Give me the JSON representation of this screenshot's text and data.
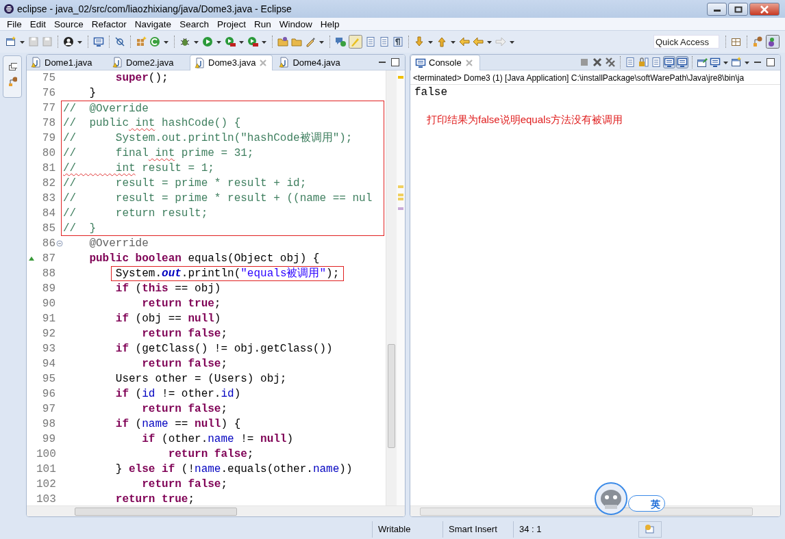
{
  "window": {
    "title": "eclipse - java_02/src/com/liaozhixiang/java/Dome3.java - Eclipse"
  },
  "menu": [
    "File",
    "Edit",
    "Source",
    "Refactor",
    "Navigate",
    "Search",
    "Project",
    "Run",
    "Window",
    "Help"
  ],
  "quick_access": {
    "placeholder": "Quick Access"
  },
  "editor": {
    "tabs": [
      {
        "label": "Dome1.java",
        "selected": false
      },
      {
        "label": "Dome2.java",
        "selected": false
      },
      {
        "label": "Dome3.java",
        "selected": true
      },
      {
        "label": "Dome4.java",
        "selected": false
      }
    ],
    "lines": [
      {
        "n": "75",
        "tokens": [
          {
            "kind": "keyword",
            "text": "        super"
          },
          {
            "kind": "plain",
            "text": "();"
          }
        ]
      },
      {
        "n": "76",
        "tokens": [
          {
            "kind": "plain",
            "text": "    }"
          }
        ]
      },
      {
        "n": "77",
        "boxed": true,
        "tokens": [
          {
            "kind": "comment",
            "text": "//  @Override"
          }
        ]
      },
      {
        "n": "78",
        "boxed": true,
        "tokens": [
          {
            "kind": "comment",
            "text": "//  public"
          },
          {
            "kind": "comment",
            "text": " int",
            "squiggly": true
          },
          {
            "kind": "comment",
            "text": " hashCode() {"
          }
        ]
      },
      {
        "n": "79",
        "boxed": true,
        "tokens": [
          {
            "kind": "comment",
            "text": "//      System.out.println(\"hashCode被调用\");"
          }
        ]
      },
      {
        "n": "80",
        "boxed": true,
        "tokens": [
          {
            "kind": "comment",
            "text": "//      final"
          },
          {
            "kind": "comment",
            "text": " int",
            "squiggly": true
          },
          {
            "kind": "comment",
            "text": " prime = 31;"
          }
        ]
      },
      {
        "n": "81",
        "boxed": true,
        "tokens": [
          {
            "kind": "comment",
            "text": "//      int",
            "squiggly": true
          },
          {
            "kind": "comment",
            "text": " result = 1;"
          }
        ]
      },
      {
        "n": "82",
        "boxed": true,
        "tokens": [
          {
            "kind": "comment",
            "text": "//      result = prime * result + id;"
          }
        ]
      },
      {
        "n": "83",
        "boxed": true,
        "tokens": [
          {
            "kind": "comment",
            "text": "//      result = prime * result + ((name == nul"
          }
        ]
      },
      {
        "n": "84",
        "boxed": true,
        "tokens": [
          {
            "kind": "comment",
            "text": "//      return result;"
          }
        ]
      },
      {
        "n": "85",
        "boxed": true,
        "tokens": [
          {
            "kind": "comment",
            "text": "//  }"
          }
        ]
      },
      {
        "n": "86",
        "foldable": true,
        "tokens": [
          {
            "kind": "annotation",
            "text": "    @Override"
          }
        ]
      },
      {
        "n": "87",
        "overrides": true,
        "tokens": [
          {
            "kind": "keyword",
            "text": "    public boolean"
          },
          {
            "kind": "plain",
            "text": " equals(Object obj) {"
          }
        ]
      },
      {
        "n": "88",
        "text_boxed": true,
        "tokens": [
          {
            "kind": "plain",
            "text": "        System."
          },
          {
            "kind": "static",
            "text": "out"
          },
          {
            "kind": "plain",
            "text": ".println("
          },
          {
            "kind": "string",
            "text": "\"equals被调用\""
          },
          {
            "kind": "plain",
            "text": ");"
          }
        ]
      },
      {
        "n": "89",
        "tokens": [
          {
            "kind": "keyword",
            "text": "        if"
          },
          {
            "kind": "plain",
            "text": " ("
          },
          {
            "kind": "keyword",
            "text": "this"
          },
          {
            "kind": "plain",
            "text": " == obj)"
          }
        ]
      },
      {
        "n": "90",
        "tokens": [
          {
            "kind": "keyword",
            "text": "            return true"
          },
          {
            "kind": "plain",
            "text": ";"
          }
        ]
      },
      {
        "n": "91",
        "tokens": [
          {
            "kind": "keyword",
            "text": "        if"
          },
          {
            "kind": "plain",
            "text": " (obj == "
          },
          {
            "kind": "keyword",
            "text": "null"
          },
          {
            "kind": "plain",
            "text": ")"
          }
        ]
      },
      {
        "n": "92",
        "tokens": [
          {
            "kind": "keyword",
            "text": "            return false"
          },
          {
            "kind": "plain",
            "text": ";"
          }
        ]
      },
      {
        "n": "93",
        "tokens": [
          {
            "kind": "keyword",
            "text": "        if"
          },
          {
            "kind": "plain",
            "text": " (getClass() != obj.getClass())"
          }
        ]
      },
      {
        "n": "94",
        "tokens": [
          {
            "kind": "keyword",
            "text": "            return false"
          },
          {
            "kind": "plain",
            "text": ";"
          }
        ]
      },
      {
        "n": "95",
        "tokens": [
          {
            "kind": "plain",
            "text": "        Users other = (Users) obj;"
          }
        ]
      },
      {
        "n": "96",
        "tokens": [
          {
            "kind": "keyword",
            "text": "        if"
          },
          {
            "kind": "plain",
            "text": " ("
          },
          {
            "kind": "field",
            "text": "id"
          },
          {
            "kind": "plain",
            "text": " != other."
          },
          {
            "kind": "field",
            "text": "id"
          },
          {
            "kind": "plain",
            "text": ")"
          }
        ]
      },
      {
        "n": "97",
        "tokens": [
          {
            "kind": "keyword",
            "text": "            return false"
          },
          {
            "kind": "plain",
            "text": ";"
          }
        ]
      },
      {
        "n": "98",
        "tokens": [
          {
            "kind": "keyword",
            "text": "        if"
          },
          {
            "kind": "plain",
            "text": " ("
          },
          {
            "kind": "field",
            "text": "name"
          },
          {
            "kind": "plain",
            "text": " == "
          },
          {
            "kind": "keyword",
            "text": "null"
          },
          {
            "kind": "plain",
            "text": ") {"
          }
        ]
      },
      {
        "n": "99",
        "tokens": [
          {
            "kind": "keyword",
            "text": "            if"
          },
          {
            "kind": "plain",
            "text": " (other."
          },
          {
            "kind": "field",
            "text": "name"
          },
          {
            "kind": "plain",
            "text": " != "
          },
          {
            "kind": "keyword",
            "text": "null"
          },
          {
            "kind": "plain",
            "text": ")"
          }
        ]
      },
      {
        "n": "100",
        "tokens": [
          {
            "kind": "keyword",
            "text": "                return false"
          },
          {
            "kind": "plain",
            "text": ";"
          }
        ]
      },
      {
        "n": "101",
        "tokens": [
          {
            "kind": "plain",
            "text": "        } "
          },
          {
            "kind": "keyword",
            "text": "else if"
          },
          {
            "kind": "plain",
            "text": " (!"
          },
          {
            "kind": "field",
            "text": "name"
          },
          {
            "kind": "plain",
            "text": ".equals(other."
          },
          {
            "kind": "field",
            "text": "name"
          },
          {
            "kind": "plain",
            "text": "))"
          }
        ]
      },
      {
        "n": "102",
        "tokens": [
          {
            "kind": "keyword",
            "text": "            return false"
          },
          {
            "kind": "plain",
            "text": ";"
          }
        ]
      },
      {
        "n": "103",
        "tokens": [
          {
            "kind": "keyword",
            "text": "        return true"
          },
          {
            "kind": "plain",
            "text": ";"
          }
        ]
      }
    ]
  },
  "console": {
    "tab": "Console",
    "terminated": "<terminated> Dome3 (1) [Java Application] C:\\installPackage\\softWarePath\\Java\\jre8\\bin\\ja",
    "output": "false",
    "note": "打印结果为false说明equals方法没有被调用"
  },
  "ime": {
    "label": "英"
  },
  "status_bar": [
    "Writable",
    "Smart Insert",
    "34 : 1"
  ]
}
